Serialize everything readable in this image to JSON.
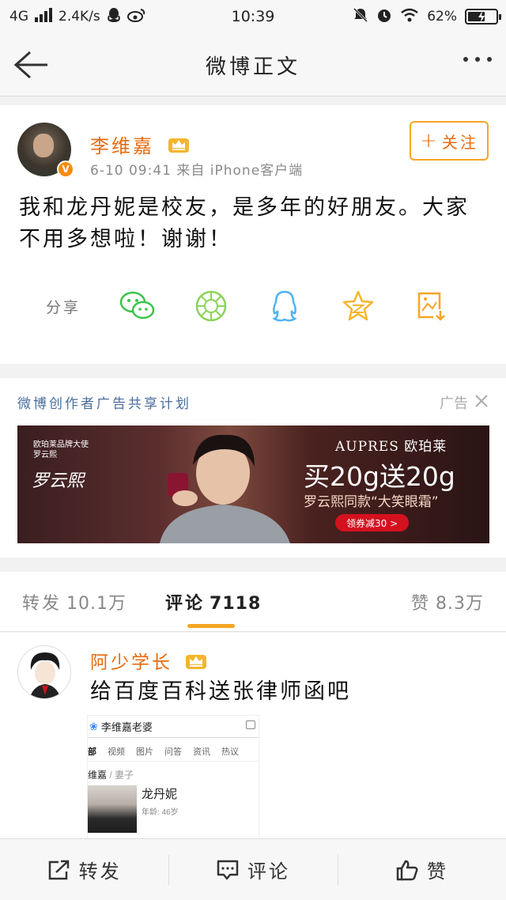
{
  "status_bar": {
    "network": "4G",
    "speed": "2.4K/s",
    "time": "10:39",
    "battery": "62%",
    "battery_level": 0.62
  },
  "nav": {
    "title": "微博正文"
  },
  "post": {
    "username": "李维嘉",
    "meta": "6-10 09:41  来自 iPhone客户端",
    "follow_label": "关注",
    "text": "我和龙丹妮是校友，是多年的好朋友。大家不用多想啦！谢谢！",
    "share_label": "分享",
    "share_icons": [
      "wechat-icon",
      "moments-icon",
      "qq-icon",
      "qzone-icon",
      "save-image-icon"
    ]
  },
  "ad": {
    "title": "微博创作者广告共享计划",
    "tag": "广告",
    "banner": {
      "small_text": "欧珀莱品牌大使 罗云熙",
      "brand": "AUPRES 欧珀莱",
      "promo": "买20g送20g",
      "sub": "罗云熙同款“大笑眼霜”",
      "cta": "领券减30 >"
    }
  },
  "tabs": {
    "repost_label": "转发",
    "repost_count": "10.1万",
    "comment_label": "评论",
    "comment_count": "7118",
    "like_label": "赞",
    "like_count": "8.3万"
  },
  "comment": {
    "username": "阿少学长",
    "text": "给百度百科送张律师函吧",
    "image": {
      "search": "李维嘉老婆",
      "tabs": [
        "部",
        "视频",
        "图片",
        "问答",
        "资讯",
        "热议"
      ],
      "relation_name": "维嘉",
      "relation_type": "妻子",
      "person_name": "龙丹妮",
      "person_age": "年龄: 46岁"
    }
  },
  "bottom_bar": {
    "repost": "转发",
    "comment": "评论",
    "like": "赞"
  },
  "colors": {
    "accent_orange": "#e86b0e",
    "follow_border": "#f5a623",
    "ad_title_blue": "#4a6e9e"
  }
}
